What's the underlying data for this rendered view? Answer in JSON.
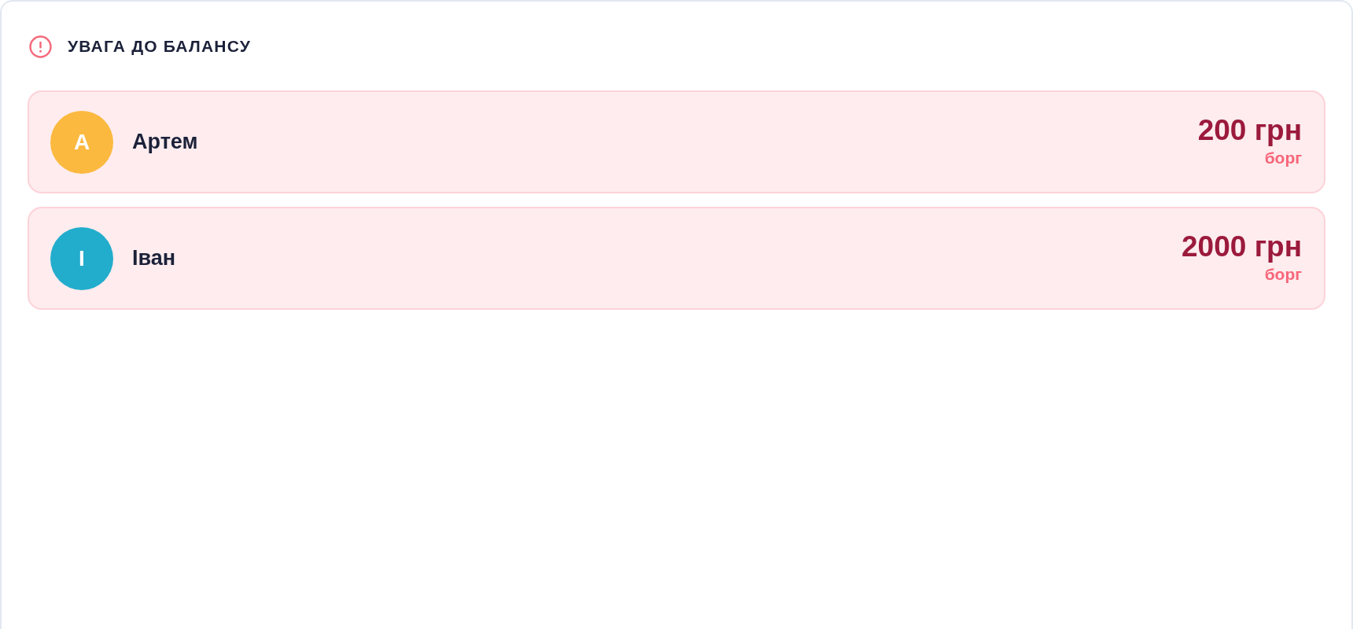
{
  "section": {
    "title": "УВАГА ДО БАЛАНСУ"
  },
  "debtors": [
    {
      "initial": "А",
      "name": "Артем",
      "color": "#fbb93f",
      "amount": "200 грн",
      "status": "борг"
    },
    {
      "initial": "І",
      "name": "Іван",
      "color": "#22adcc",
      "amount": "2000 грн",
      "status": "борг"
    }
  ]
}
